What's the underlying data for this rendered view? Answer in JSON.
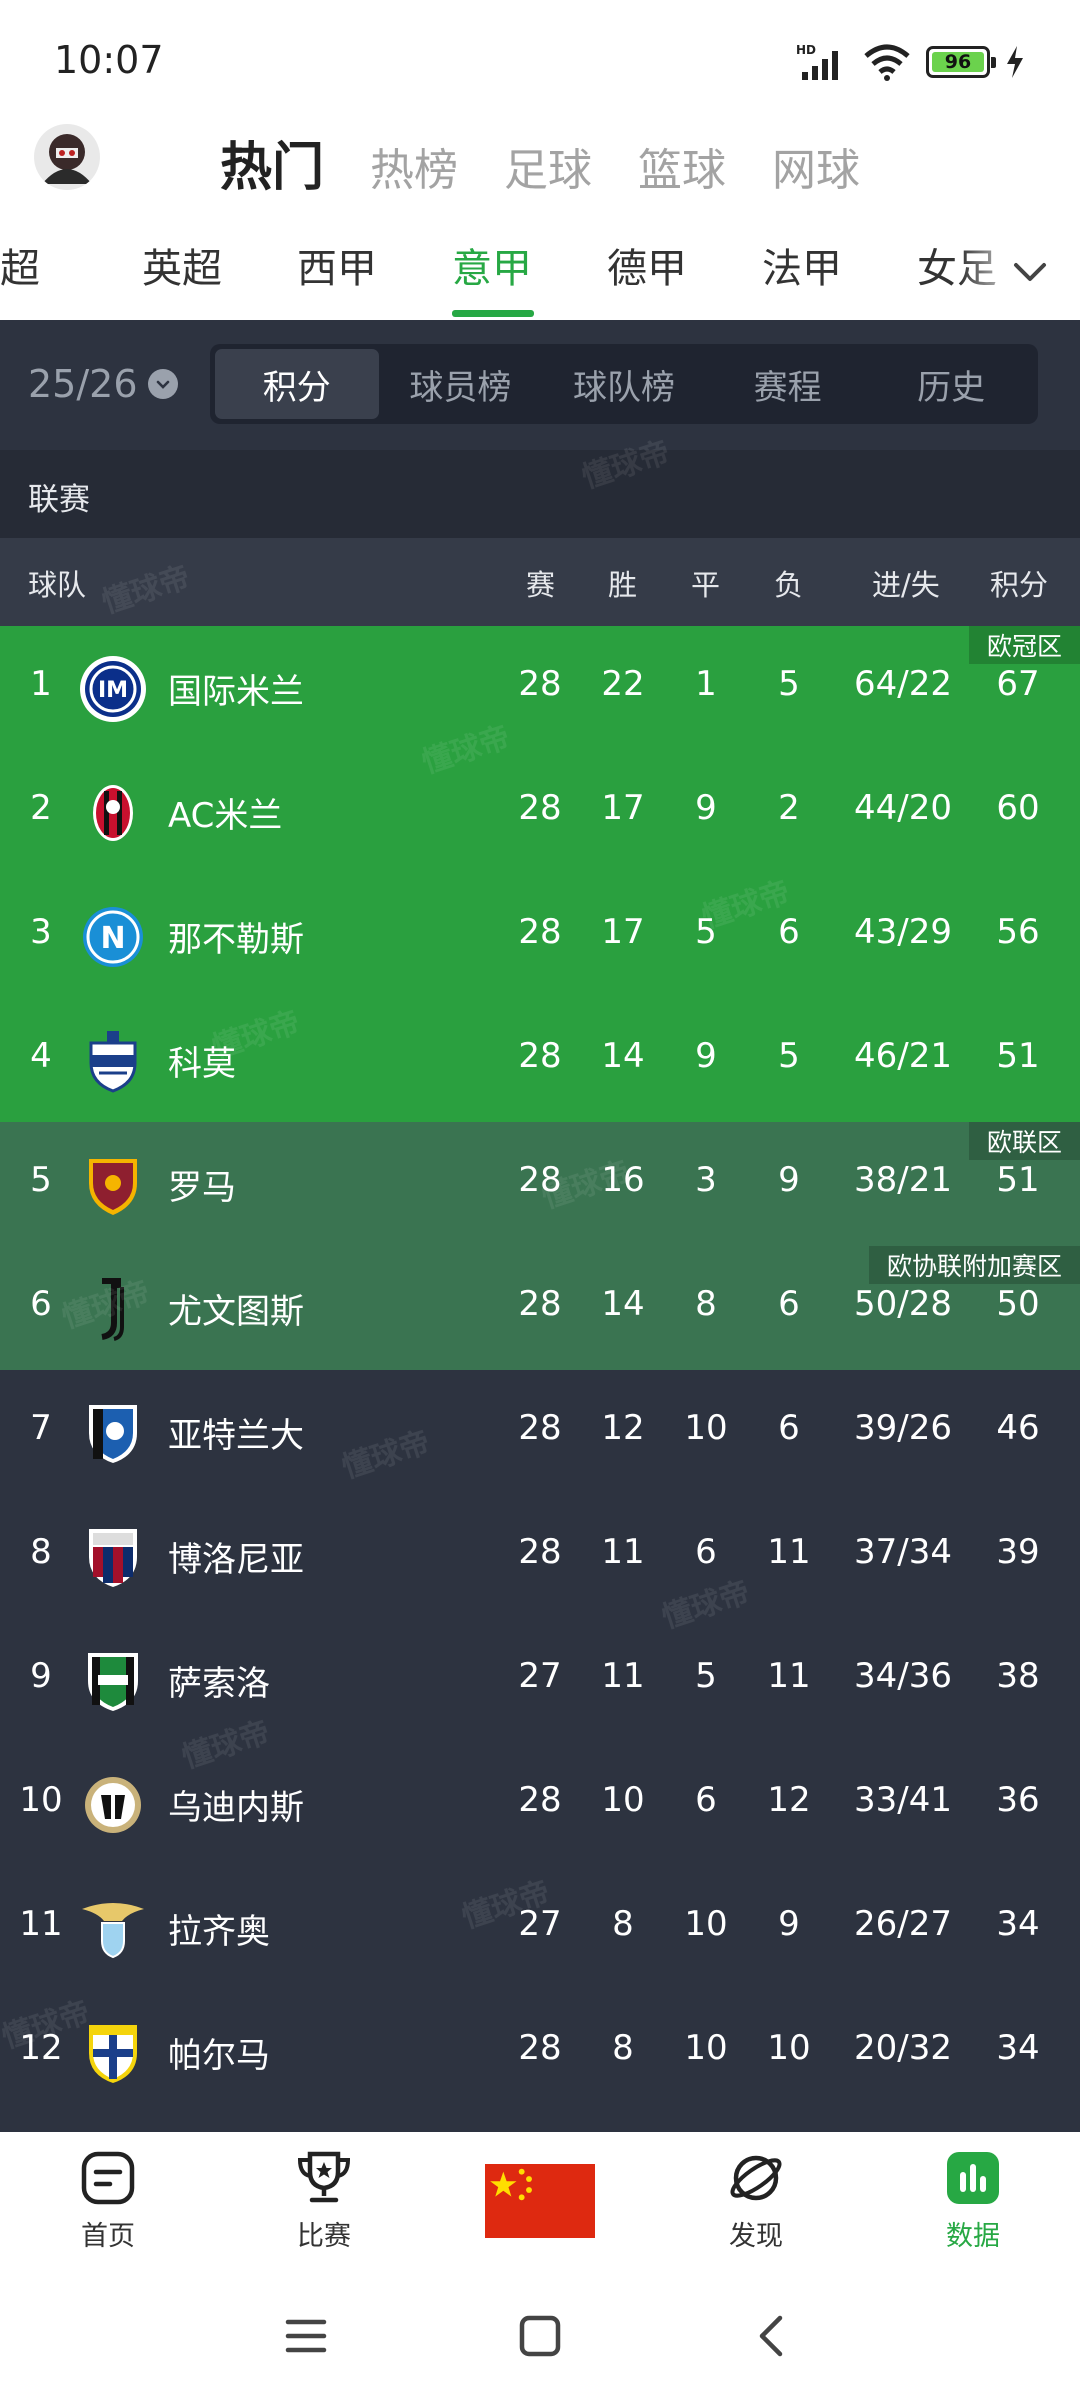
{
  "status_bar": {
    "time": "10:07",
    "network": "HD",
    "battery": "96"
  },
  "header": {
    "tabs": [
      {
        "label": "热门",
        "active": true
      },
      {
        "label": "热榜",
        "active": false
      },
      {
        "label": "足球",
        "active": false
      },
      {
        "label": "篮球",
        "active": false
      },
      {
        "label": "网球",
        "active": false
      }
    ]
  },
  "league_tabs": [
    {
      "label": "中超",
      "active": false
    },
    {
      "label": "英超",
      "active": false
    },
    {
      "label": "西甲",
      "active": false
    },
    {
      "label": "意甲",
      "active": true
    },
    {
      "label": "德甲",
      "active": false
    },
    {
      "label": "法甲",
      "active": false
    },
    {
      "label": "女足",
      "active": false
    }
  ],
  "season": {
    "label": "25/26"
  },
  "segments": [
    {
      "label": "积分",
      "active": true
    },
    {
      "label": "球员榜",
      "active": false
    },
    {
      "label": "球队榜",
      "active": false
    },
    {
      "label": "赛程",
      "active": false
    },
    {
      "label": "历史",
      "active": false
    }
  ],
  "section_label": "联赛",
  "columns": {
    "team": "球队",
    "played": "赛",
    "won": "胜",
    "drawn": "平",
    "lost": "负",
    "goals": "进/失",
    "points": "积分"
  },
  "zones": {
    "cl": "欧冠区",
    "el": "欧联区",
    "conf": "欧协联附加赛区"
  },
  "standings": [
    {
      "rank": "1",
      "team": "国际米兰",
      "played": "28",
      "won": "22",
      "drawn": "1",
      "lost": "5",
      "goals": "64/22",
      "points": "67"
    },
    {
      "rank": "2",
      "team": "AC米兰",
      "played": "28",
      "won": "17",
      "drawn": "9",
      "lost": "2",
      "goals": "44/20",
      "points": "60"
    },
    {
      "rank": "3",
      "team": "那不勒斯",
      "played": "28",
      "won": "17",
      "drawn": "5",
      "lost": "6",
      "goals": "43/29",
      "points": "56"
    },
    {
      "rank": "4",
      "team": "科莫",
      "played": "28",
      "won": "14",
      "drawn": "9",
      "lost": "5",
      "goals": "46/21",
      "points": "51"
    },
    {
      "rank": "5",
      "team": "罗马",
      "played": "28",
      "won": "16",
      "drawn": "3",
      "lost": "9",
      "goals": "38/21",
      "points": "51"
    },
    {
      "rank": "6",
      "team": "尤文图斯",
      "played": "28",
      "won": "14",
      "drawn": "8",
      "lost": "6",
      "goals": "50/28",
      "points": "50"
    },
    {
      "rank": "7",
      "team": "亚特兰大",
      "played": "28",
      "won": "12",
      "drawn": "10",
      "lost": "6",
      "goals": "39/26",
      "points": "46"
    },
    {
      "rank": "8",
      "team": "博洛尼亚",
      "played": "28",
      "won": "11",
      "drawn": "6",
      "lost": "11",
      "goals": "37/34",
      "points": "39"
    },
    {
      "rank": "9",
      "team": "萨索洛",
      "played": "27",
      "won": "11",
      "drawn": "5",
      "lost": "11",
      "goals": "34/36",
      "points": "38"
    },
    {
      "rank": "10",
      "team": "乌迪内斯",
      "played": "28",
      "won": "10",
      "drawn": "6",
      "lost": "12",
      "goals": "33/41",
      "points": "36"
    },
    {
      "rank": "11",
      "team": "拉齐奥",
      "played": "27",
      "won": "8",
      "drawn": "10",
      "lost": "9",
      "goals": "26/27",
      "points": "34"
    },
    {
      "rank": "12",
      "team": "帕尔马",
      "played": "28",
      "won": "8",
      "drawn": "10",
      "lost": "10",
      "goals": "20/32",
      "points": "34"
    }
  ],
  "watermark": "懂球帝",
  "bottom_nav": [
    {
      "label": "首页",
      "icon": "home-doc-icon",
      "active": false
    },
    {
      "label": "比赛",
      "icon": "trophy-icon",
      "active": false
    },
    {
      "label": "发现",
      "icon": "planet-icon",
      "active": false
    },
    {
      "label": "数据",
      "icon": "bar-chart-icon",
      "active": true
    }
  ],
  "colors": {
    "accent": "#27a844",
    "cl_zone": "#2aa03f",
    "el_zone": "#3a7451",
    "table_bg": "#2d3340"
  }
}
